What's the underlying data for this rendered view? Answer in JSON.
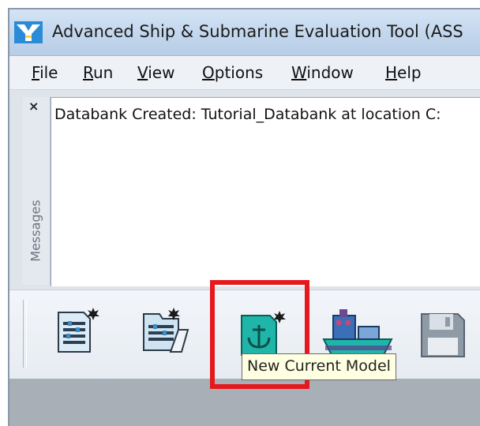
{
  "window": {
    "title": "Advanced Ship & Submarine Evaluation Tool (ASS"
  },
  "menu": [
    {
      "key": "F",
      "rest": "ile"
    },
    {
      "key": "R",
      "rest": "un"
    },
    {
      "key": "V",
      "rest": "iew"
    },
    {
      "key": "O",
      "rest": "ptions"
    },
    {
      "key": "W",
      "rest": "indow"
    },
    {
      "key": "H",
      "rest": "elp"
    }
  ],
  "messages": {
    "panel_label": "Messages",
    "close_glyph": "×",
    "text": "Databank Created: Tutorial_Databank at location C:"
  },
  "toolbar": {
    "buttons": [
      {
        "name": "new-databank",
        "icon": "new-document-icon"
      },
      {
        "name": "open-databank",
        "icon": "open-folder-document-icon"
      },
      {
        "name": "new-current-model",
        "icon": "anchor-model-icon",
        "highlighted": true
      },
      {
        "name": "ship-model",
        "icon": "ship-icon"
      },
      {
        "name": "save",
        "icon": "floppy-disk-icon"
      }
    ],
    "tooltip": "New Current Model"
  },
  "colors": {
    "highlight": "#e5191d",
    "model_icon": "#1fb5a8",
    "tooltip_bg": "#ffffe1"
  }
}
